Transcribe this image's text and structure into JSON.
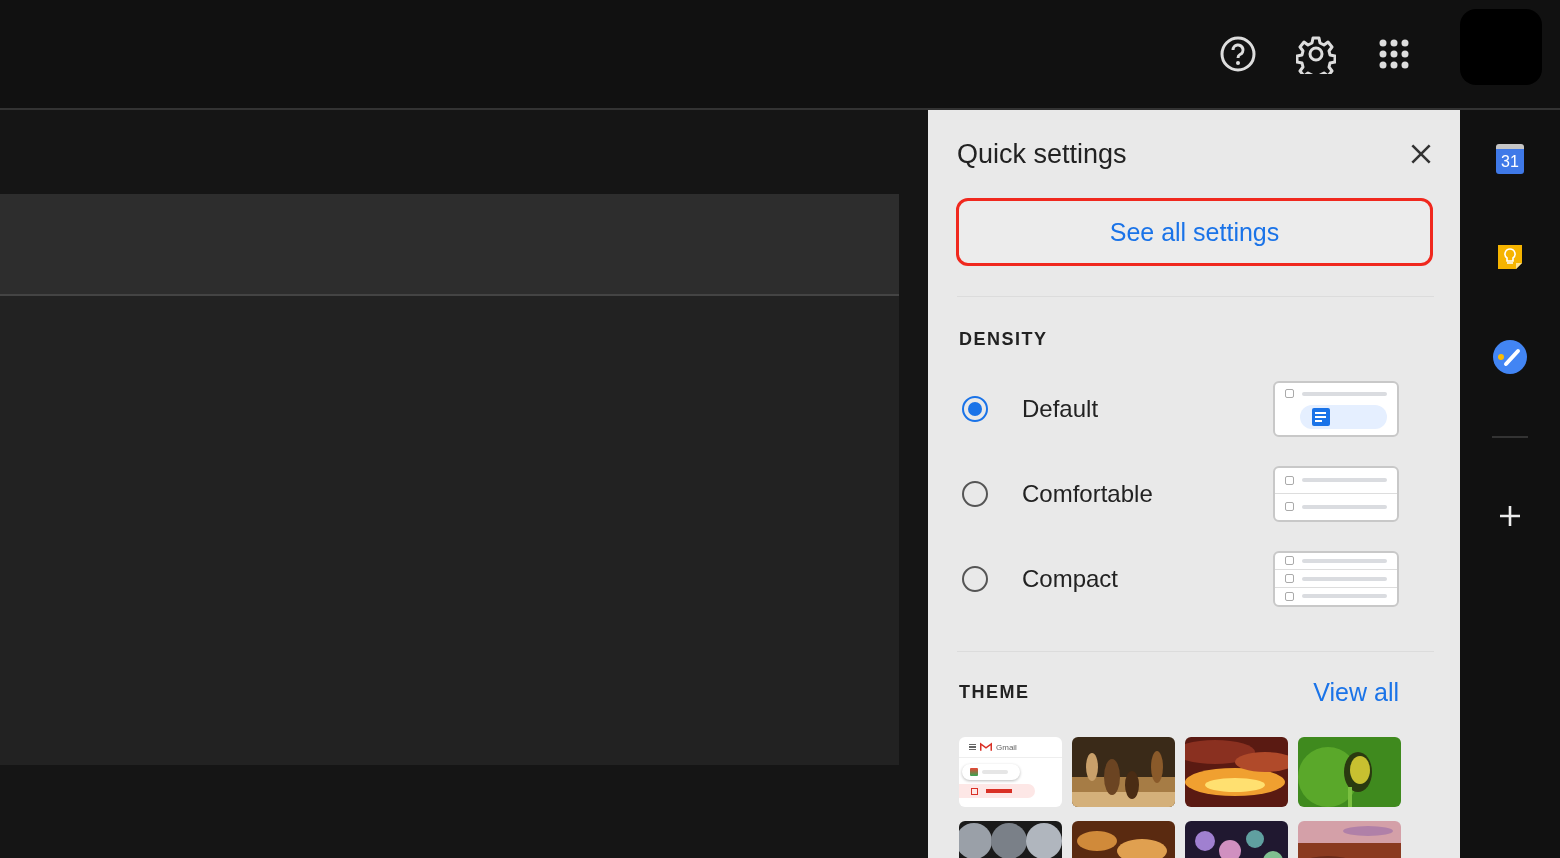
{
  "quick_settings": {
    "title": "Quick settings",
    "see_all_button": {
      "label": "See all settings",
      "highlighted": true
    },
    "density": {
      "heading": "DENSITY",
      "options": [
        {
          "label": "Default",
          "kind": "default",
          "selected": true
        },
        {
          "label": "Comfortable",
          "kind": "comfortable",
          "selected": false
        },
        {
          "label": "Compact",
          "kind": "compact",
          "selected": false
        }
      ]
    },
    "theme": {
      "heading": "THEME",
      "view_all": "View all",
      "themes": [
        {
          "kind": "preview",
          "app_name": "Gmail"
        },
        {
          "kind": "picture"
        },
        {
          "kind": "picture"
        },
        {
          "kind": "picture"
        },
        {
          "kind": "picture"
        },
        {
          "kind": "picture"
        },
        {
          "kind": "picture"
        },
        {
          "kind": "picture"
        }
      ]
    }
  },
  "side_rail": {
    "calendar_day": "31"
  }
}
